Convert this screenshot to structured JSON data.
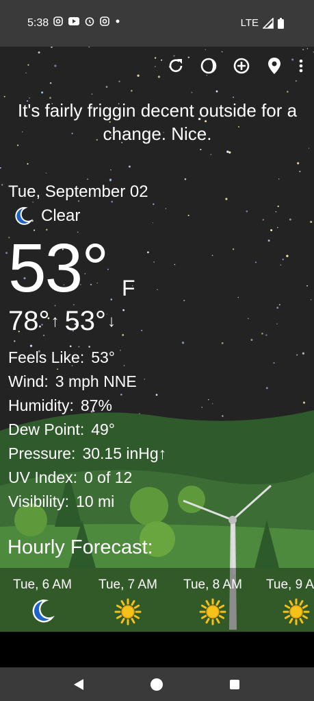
{
  "status_bar": {
    "time": "5:38",
    "network": "LTE",
    "icons": [
      "instagram-icon",
      "youtube-icon",
      "alarm-icon",
      "instagram-icon",
      "dot-icon"
    ]
  },
  "toolbar": {
    "icons": [
      "refresh-icon",
      "moon-phase-icon",
      "add-location-icon",
      "location-pin-icon",
      "more-vert-icon"
    ]
  },
  "headline": "It's fairly friggin decent outside for a change. Nice.",
  "current": {
    "date": "Tue, September 02",
    "condition": "Clear",
    "temp": "53°",
    "unit": "F",
    "high": "78°",
    "high_arrow": "↑",
    "low": "53°",
    "low_arrow": "↓"
  },
  "details": [
    {
      "label": "Feels Like:",
      "value": "53°"
    },
    {
      "label": "Wind:",
      "value": "3 mph NNE"
    },
    {
      "label": "Humidity:",
      "value": "87%"
    },
    {
      "label": "Dew Point:",
      "value": "49°"
    },
    {
      "label": "Pressure:",
      "value": "30.15 inHg↑"
    },
    {
      "label": "UV Index:",
      "value": "0 of 12"
    },
    {
      "label": "Visibility:",
      "value": "10 mi"
    }
  ],
  "hourly_title": "Hourly Forecast:",
  "hourly": [
    {
      "time": "Tue, 6 AM",
      "icon": "moon-icon"
    },
    {
      "time": "Tue, 7 AM",
      "icon": "sun-icon"
    },
    {
      "time": "Tue, 8 AM",
      "icon": "sun-icon"
    },
    {
      "time": "Tue, 9 A",
      "icon": "sun-icon"
    }
  ],
  "colors": {
    "moon": "#1e63c8",
    "sun": "#f6c21a",
    "sky": "#232323",
    "hills": "#3f7a3a"
  }
}
